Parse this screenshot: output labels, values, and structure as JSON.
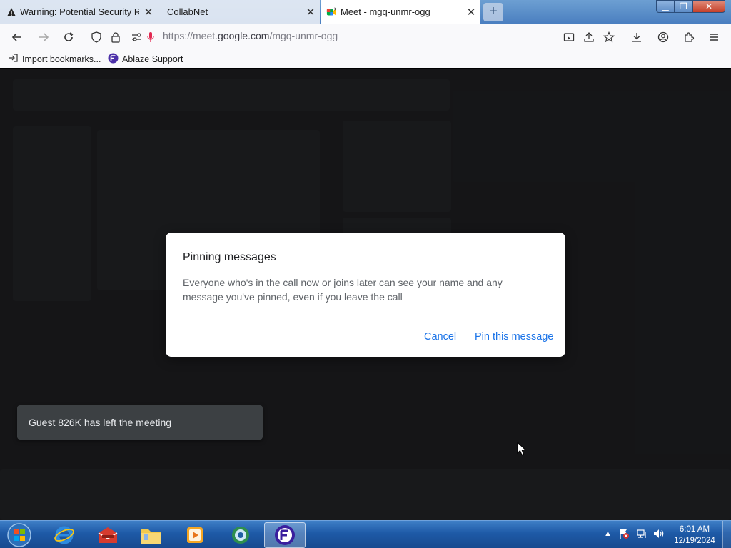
{
  "browser": {
    "tabs": [
      {
        "title": "Warning: Potential Security Risk",
        "icon": "warning-icon",
        "active": false
      },
      {
        "title": "CollabNet",
        "icon": "",
        "active": false
      },
      {
        "title": "Meet - mgq-unmr-ogg",
        "icon": "google-meet-icon",
        "active": true
      }
    ],
    "new_tab_label": "+",
    "url_prefix": "https://meet.",
    "url_domain": "google.com",
    "url_path": "/mgq-unmr-ogg",
    "bookmarks": [
      {
        "label": "Import bookmarks...",
        "icon": "import-icon"
      },
      {
        "label": "Ablaze Support",
        "icon": "ablaze-icon"
      }
    ]
  },
  "dialog": {
    "title": "Pinning messages",
    "body": "Everyone who's in the call now or joins later can see your name and any message you've pinned, even if you leave the call",
    "cancel_label": "Cancel",
    "confirm_label": "Pin this message",
    "accent": "#1a73e8"
  },
  "toast": {
    "text": "Guest 826K has left the meeting"
  },
  "taskbar": {
    "time": "6:01 AM",
    "date": "12/19/2024",
    "apps": [
      "start-orb",
      "internet-explorer",
      "toolbox",
      "file-explorer",
      "media-player",
      "network-app",
      "floorp-browser"
    ]
  }
}
